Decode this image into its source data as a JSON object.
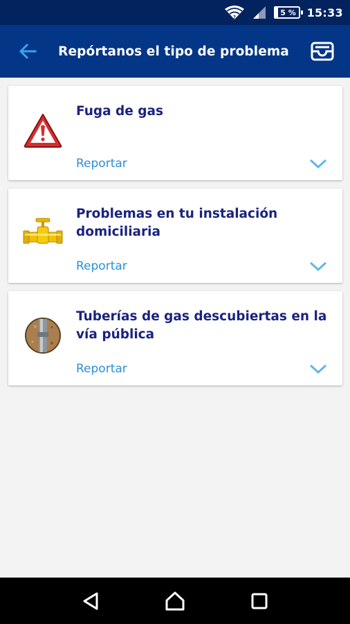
{
  "status_bar": {
    "battery_text": "5 %",
    "time": "15:33",
    "icons": [
      "wifi-icon",
      "signal-icon",
      "battery-icon"
    ]
  },
  "app_bar": {
    "title": "Repórtanos el tipo de problema",
    "back_icon": "arrow-back-icon",
    "inbox_icon": "inbox-icon",
    "color": "#033686"
  },
  "problems": [
    {
      "title": "Fuga de gas",
      "action": "Reportar",
      "icon": "warning-triangle-icon"
    },
    {
      "title": "Problemas en tu instalación domiciliaria",
      "action": "Reportar",
      "icon": "gas-pipe-valve-icon"
    },
    {
      "title": "Tuberías de gas descubiertas en la vía pública",
      "action": "Reportar",
      "icon": "exposed-pipe-icon"
    }
  ],
  "colors": {
    "title_text": "#1a237e",
    "action_text": "#2b8fd6",
    "chevron": "#5fb7e5"
  },
  "nav_bar": {
    "icons": [
      "nav-back-icon",
      "nav-home-icon",
      "nav-recents-icon"
    ]
  }
}
